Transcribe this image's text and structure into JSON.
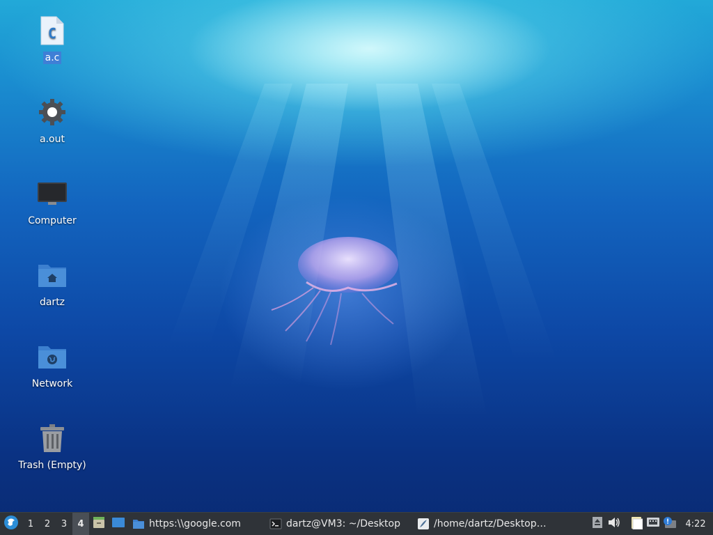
{
  "desktop": {
    "icons": [
      {
        "label": "a.c",
        "icon": "c-source-file-icon",
        "selected": true
      },
      {
        "label": "a.out",
        "icon": "executable-gear-icon"
      },
      {
        "label": "Computer",
        "icon": "computer-monitor-icon"
      },
      {
        "label": "dartz",
        "icon": "home-folder-icon"
      },
      {
        "label": "Network",
        "icon": "network-folder-icon"
      },
      {
        "label": "Trash (Empty)",
        "icon": "trash-icon"
      }
    ],
    "file_glyph_letter": "C"
  },
  "taskbar": {
    "menu_icon": "start-menu-icon",
    "workspaces": [
      "1",
      "2",
      "3",
      "4"
    ],
    "active_workspace": "4",
    "quick_launch": [
      "file-manager-icon",
      "show-desktop-icon"
    ],
    "tasks": [
      {
        "label": "https:\\\\google.com",
        "icon": "folder-icon"
      },
      {
        "label": "dartz@VM3: ~/Desktop",
        "icon": "terminal-icon"
      },
      {
        "label": "/home/dartz/Desktop…",
        "icon": "text-editor-icon"
      }
    ],
    "tray": [
      "eject-icon",
      "volume-icon",
      "clipboard-icon",
      "network-wired-icon",
      "update-notifier-icon"
    ],
    "clock": "4:22"
  },
  "colors": {
    "taskbar_bg": "#2f3338",
    "selection": "#3f7fd6",
    "folder_blue": "#4a8fd9"
  }
}
